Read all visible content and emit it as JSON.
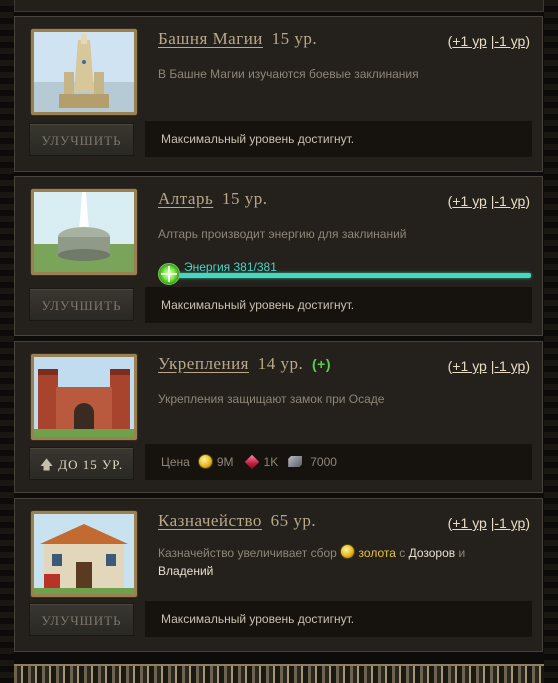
{
  "buildings": [
    {
      "name": "Башня Магии",
      "level": "15 ур.",
      "plus_link": "+1 ур",
      "minus_link": "-1 ур",
      "description": "В Башне Магии изучаются боевые заклинания",
      "button": "Улучшить",
      "status": "Максимальный уровень достигнут.",
      "image_icon": "magic-tower"
    },
    {
      "name": "Алтарь",
      "level": "15 ур.",
      "plus_link": "+1 ур",
      "minus_link": "-1 ур",
      "description": "Алтарь производит энергию для заклинаний",
      "energy_text": "Энергия 381/381",
      "energy_fraction": 1.0,
      "button": "Улучшить",
      "status": "Максимальный уровень достигнут.",
      "image_icon": "altar"
    },
    {
      "name": "Укрепления",
      "level": "14 ур.",
      "badge": "(+)",
      "plus_link": "+1 ур",
      "minus_link": "-1 ур",
      "description": "Укрепления защищают замок при Осаде",
      "button": "до 15 ур.",
      "price_label": "Цена",
      "price_gold": "9M",
      "price_gems": "1K",
      "price_stone": "7000",
      "image_icon": "fortifications"
    },
    {
      "name": "Казначейство",
      "level": "65 ур.",
      "plus_link": "+1 ур",
      "minus_link": "-1 ур",
      "desc_part1": "Казначейство увеличивает сбор",
      "desc_gold": "золота",
      "desc_part2": "с",
      "desc_link1": "Дозоров",
      "desc_part3": "и",
      "desc_link2": "Владений",
      "button": "Улучшить",
      "status": "Максимальный уровень достигнут.",
      "image_icon": "treasury"
    }
  ],
  "separator": "|",
  "paren_open": "(",
  "paren_close": ")",
  "colors": {
    "gold_text": "#e6c23a",
    "energy": "#47d8c0",
    "plus_badge": "#5ad04a"
  }
}
